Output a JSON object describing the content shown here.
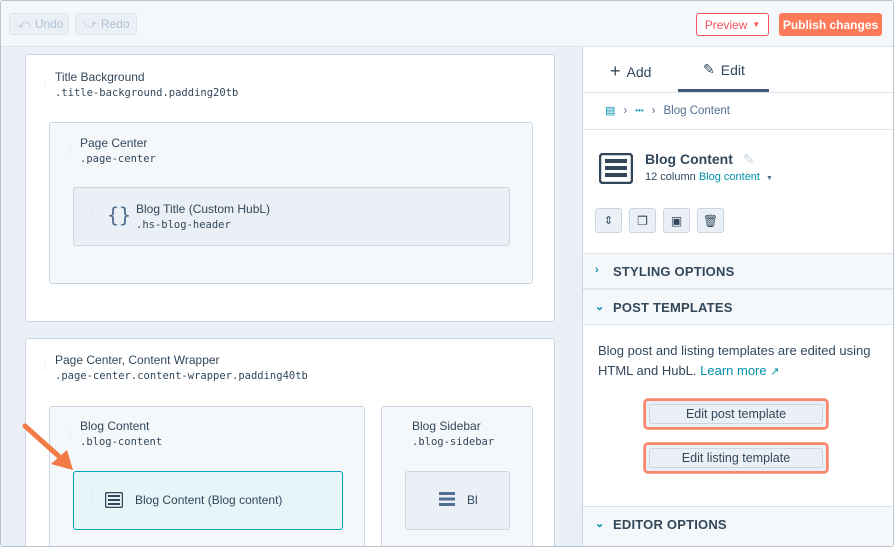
{
  "toolbar": {
    "undo_label": "Undo",
    "redo_label": "Redo",
    "preview_label": "Preview",
    "publish_label": "Publish changes"
  },
  "canvas": {
    "title_background": {
      "name": "Title Background",
      "class": ".title-background.padding20tb"
    },
    "page_center": {
      "name": "Page Center",
      "class": ".page-center"
    },
    "blog_title": {
      "name": "Blog Title (Custom HubL)",
      "class": ".hs-blog-header"
    },
    "content_wrapper": {
      "name": "Page Center, Content Wrapper",
      "class": ".page-center.content-wrapper.padding40tb"
    },
    "blog_content_col": {
      "name": "Blog Content",
      "class": ".blog-content"
    },
    "blog_content_module": {
      "name": "Blog Content (Blog content)"
    },
    "blog_sidebar_col": {
      "name": "Blog Sidebar",
      "class": ".blog-sidebar"
    },
    "sidebar_module_partial": "Bl"
  },
  "panel": {
    "tabs": [
      {
        "label": "Add",
        "icon": "plus-icon"
      },
      {
        "label": "Edit",
        "icon": "pencil-icon",
        "active": true
      }
    ],
    "breadcrumb": {
      "ellipsis": "•••",
      "current": "Blog Content"
    },
    "module": {
      "title": "Blog Content",
      "columns": "12 column",
      "type": "Blog content"
    },
    "sections": {
      "styling": "STYLING OPTIONS",
      "post_templates": "POST TEMPLATES",
      "editor": "EDITOR OPTIONS"
    },
    "post_templates": {
      "description": "Blog post and listing templates are edited using HTML and HubL.",
      "learn_more": "Learn more",
      "edit_post_label": "Edit post template",
      "edit_listing_label": "Edit listing template"
    }
  },
  "colors": {
    "accent_orange": "#ff7a59",
    "preview_red": "#f2545b",
    "link_teal": "#0091ae",
    "selected_bg": "#e5f5f8",
    "selected_border": "#00a4bd"
  }
}
